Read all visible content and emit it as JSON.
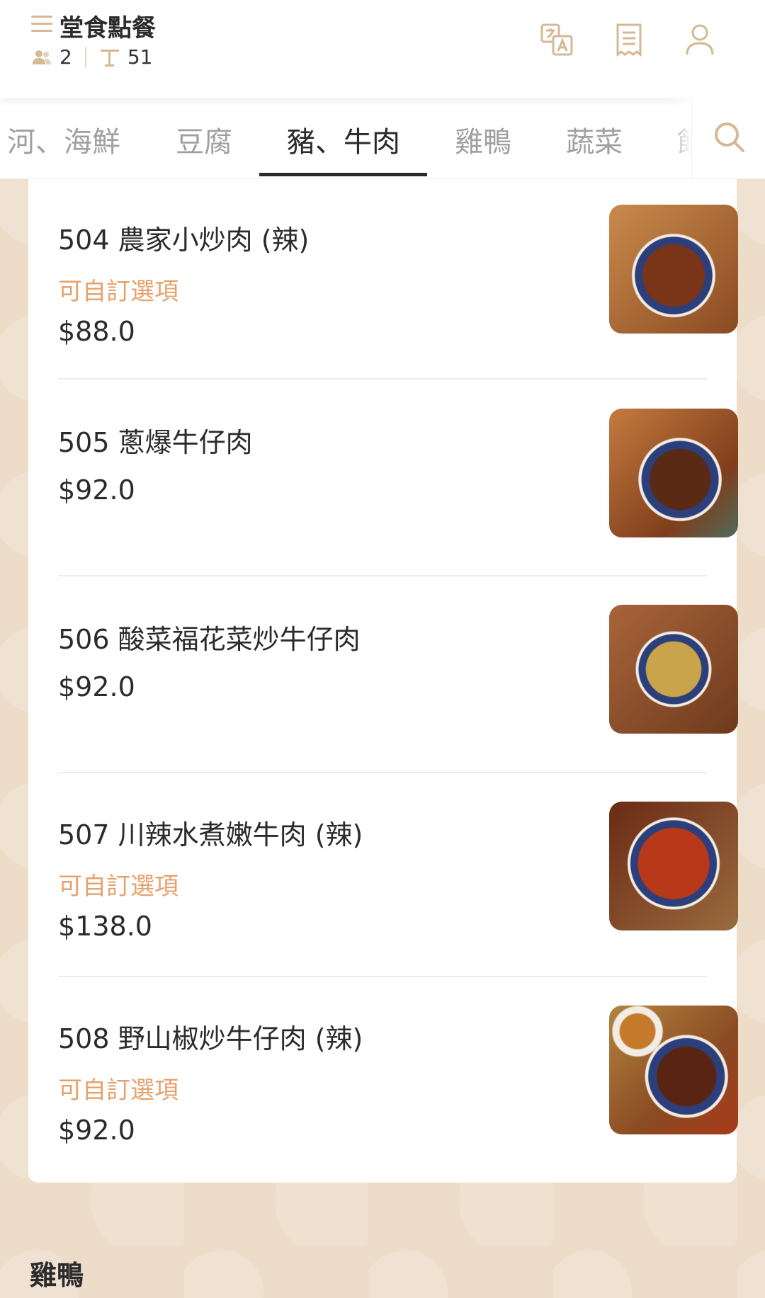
{
  "header": {
    "title": "堂食點餐",
    "guests": "2",
    "table": "51"
  },
  "tabs": [
    {
      "label": "河、海鮮",
      "active": false
    },
    {
      "label": "豆腐",
      "active": false
    },
    {
      "label": "豬、牛肉",
      "active": true
    },
    {
      "label": "雞鴨",
      "active": false
    },
    {
      "label": "蔬菜",
      "active": false
    },
    {
      "label": "飯",
      "active": false
    }
  ],
  "items": [
    {
      "name": "504 農家小炒肉 (辣)",
      "custom": "可自訂選項",
      "price": "$88.0"
    },
    {
      "name": "505 蔥爆牛仔肉",
      "custom": "",
      "price": "$92.0"
    },
    {
      "name": "506 酸菜福花菜炒牛仔肉",
      "custom": "",
      "price": "$92.0"
    },
    {
      "name": "507 川辣水煮嫩牛肉 (辣)",
      "custom": "可自訂選項",
      "price": "$138.0"
    },
    {
      "name": "508 野山椒炒牛仔肉 (辣)",
      "custom": "可自訂選項",
      "price": "$92.0"
    }
  ],
  "next_section": "雞鴨",
  "colors": {
    "accent": "#d5b894",
    "custom_option": "#e7a16c",
    "background": "#ecdcc8"
  },
  "icons": [
    "menu-icon",
    "people-icon",
    "table-icon",
    "translate-icon",
    "receipt-icon",
    "user-icon",
    "search-icon"
  ]
}
